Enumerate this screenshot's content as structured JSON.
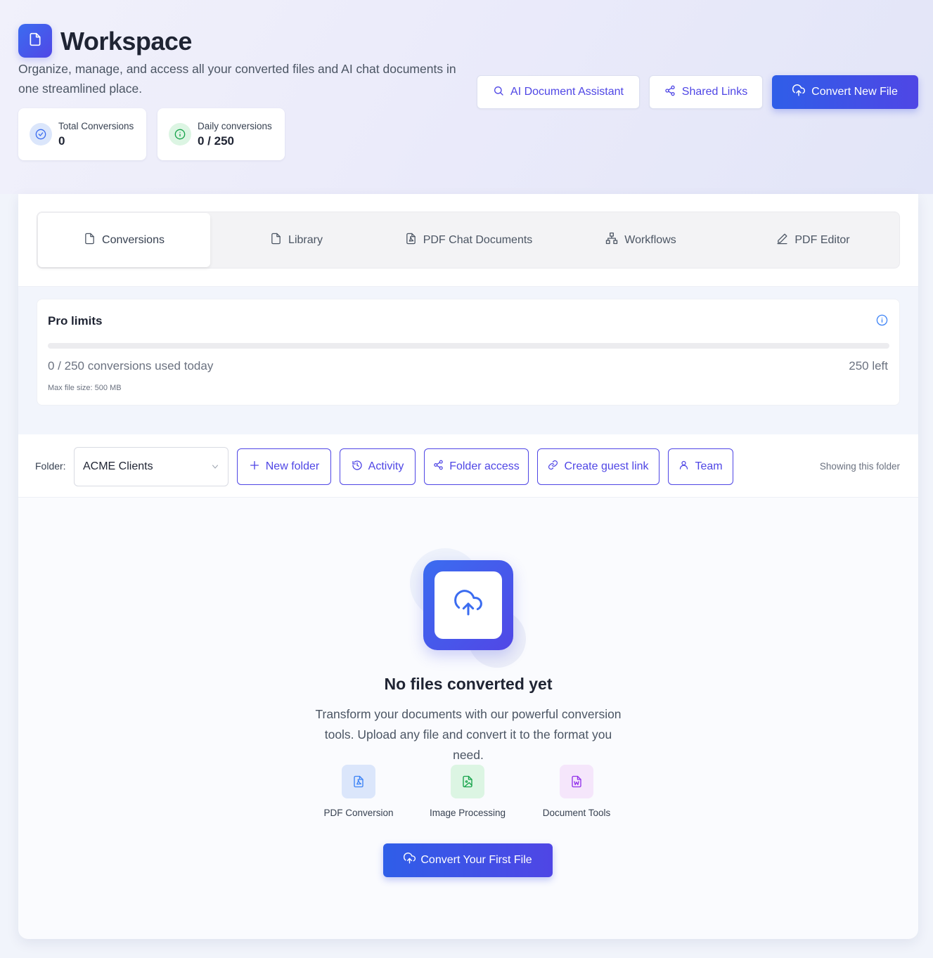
{
  "header": {
    "title": "Workspace",
    "subtitle": "Organize, manage, and access all your converted files and AI chat documents in one streamlined place.",
    "logo_icon": "file-icon",
    "stats": [
      {
        "label": "Total Conversions",
        "value": "0",
        "icon": "check-circle-icon",
        "color": "#3b6cf0"
      },
      {
        "label": "Daily conversions",
        "value": "0 / 250",
        "icon": "info-icon",
        "color": "#16a34a"
      }
    ],
    "actions": {
      "ai_assistant": "AI Document Assistant",
      "shared_links": "Shared Links",
      "convert_new": "Convert New File"
    }
  },
  "tabs": [
    {
      "label": "Conversions",
      "icon": "file-icon",
      "active": true
    },
    {
      "label": "Library",
      "icon": "file-icon",
      "active": false
    },
    {
      "label": "PDF Chat Documents",
      "icon": "pdf-file-icon",
      "active": false
    },
    {
      "label": "Workflows",
      "icon": "workflow-icon",
      "active": false
    },
    {
      "label": "PDF Editor",
      "icon": "pencil-icon",
      "active": false
    }
  ],
  "limits": {
    "title": "Pro limits",
    "used_text": "0 / 250 conversions used today",
    "left_text": "250 left",
    "max_size": "Max file size: 500 MB",
    "progress_fraction": 0
  },
  "folder": {
    "label": "Folder:",
    "selected": "ACME Clients",
    "buttons": {
      "new_folder": "New folder",
      "activity": "Activity",
      "folder_access": "Folder access",
      "guest_link": "Create guest link",
      "team": "Team"
    },
    "showing": "Showing this folder"
  },
  "empty_state": {
    "title": "No files converted yet",
    "description": "Transform your documents with our powerful conversion tools. Upload any file and convert it to the format you need.",
    "features": [
      {
        "label": "PDF Conversion",
        "icon": "pdf-file-icon",
        "color": "#3b82f6"
      },
      {
        "label": "Image Processing",
        "icon": "image-file-icon",
        "color": "#16a34a"
      },
      {
        "label": "Document Tools",
        "icon": "word-file-icon",
        "color": "#9333ea"
      }
    ],
    "cta": "Convert Your First File"
  },
  "colors": {
    "primary": "#4f46e5",
    "primary_start": "#2f5ee8"
  }
}
